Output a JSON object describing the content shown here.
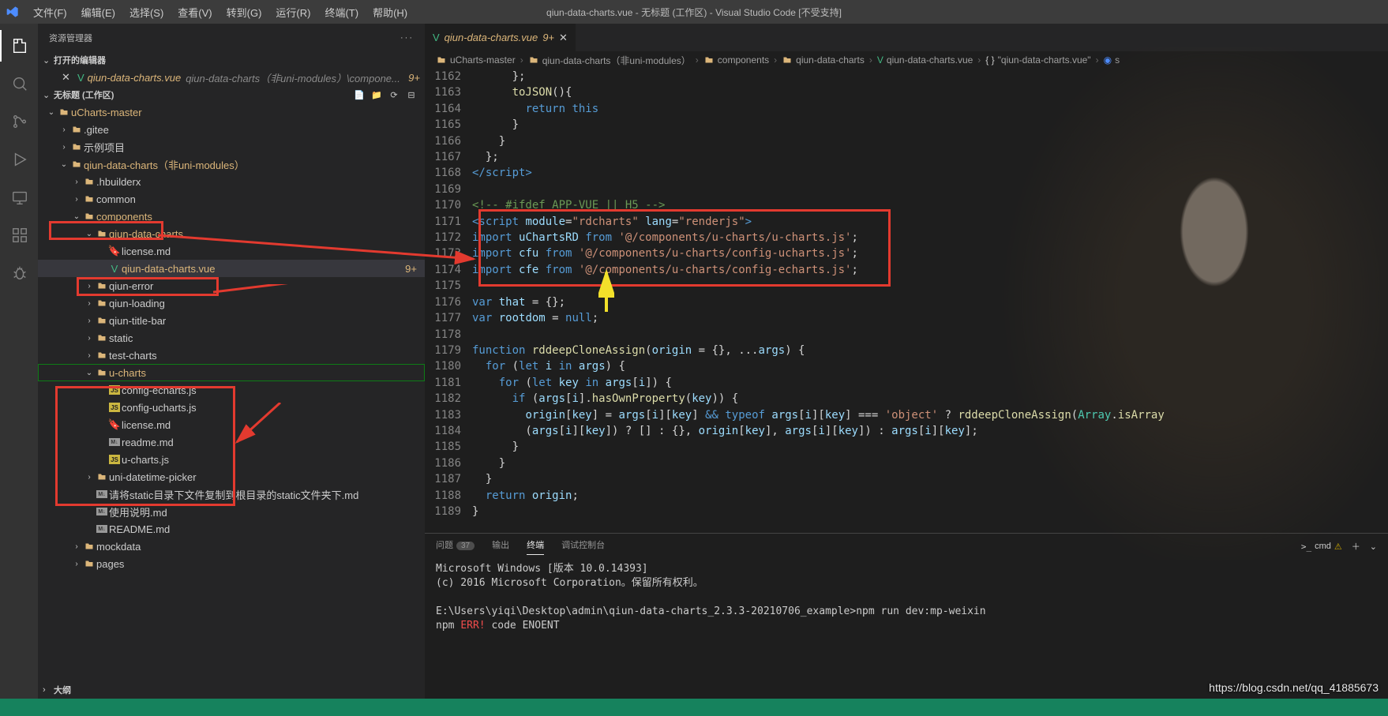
{
  "window": {
    "title": "qiun-data-charts.vue - 无标题 (工作区) - Visual Studio Code [不受支持]"
  },
  "menu": [
    "文件(F)",
    "编辑(E)",
    "选择(S)",
    "查看(V)",
    "转到(G)",
    "运行(R)",
    "终端(T)",
    "帮助(H)"
  ],
  "sidebar": {
    "title": "资源管理器",
    "openEditorsLabel": "打开的编辑器",
    "workspaceLabel": "无标题 (工作区)",
    "openEditors": [
      {
        "icon": "vue",
        "name": "qiun-data-charts.vue",
        "path": "qiun-data-charts（非uni-modules）\\compone...",
        "badge": "9+"
      }
    ],
    "tree": [
      {
        "d": 0,
        "ch": "v",
        "ico": "folder",
        "name": "uCharts-master",
        "tint": "#dcb67a"
      },
      {
        "d": 1,
        "ch": ">",
        "ico": "folder",
        "name": ".gitee"
      },
      {
        "d": 1,
        "ch": ">",
        "ico": "folder",
        "name": "示例项目"
      },
      {
        "d": 1,
        "ch": "v",
        "ico": "folder",
        "name": "qiun-data-charts（非uni-modules）",
        "tint": "#dcb67a"
      },
      {
        "d": 2,
        "ch": ">",
        "ico": "folder",
        "name": ".hbuilderx"
      },
      {
        "d": 2,
        "ch": ">",
        "ico": "folder",
        "name": "common"
      },
      {
        "d": 2,
        "ch": "v",
        "ico": "folder",
        "name": "components",
        "tint": "#dcb67a",
        "box": "components"
      },
      {
        "d": 3,
        "ch": "v",
        "ico": "folder",
        "name": "qiun-data-charts",
        "tint": "#dcb67a"
      },
      {
        "d": 4,
        "ch": "",
        "ico": "cert",
        "name": "license.md"
      },
      {
        "d": 4,
        "ch": "",
        "ico": "vue",
        "name": "qiun-data-charts.vue",
        "tint": "#dcb67a",
        "active": true,
        "badge": "9+",
        "box": "vuefile"
      },
      {
        "d": 3,
        "ch": ">",
        "ico": "folder",
        "name": "qiun-error"
      },
      {
        "d": 3,
        "ch": ">",
        "ico": "folder",
        "name": "qiun-loading"
      },
      {
        "d": 3,
        "ch": ">",
        "ico": "folder",
        "name": "qiun-title-bar"
      },
      {
        "d": 3,
        "ch": ">",
        "ico": "folder",
        "name": "static"
      },
      {
        "d": 3,
        "ch": ">",
        "ico": "folder",
        "name": "test-charts"
      },
      {
        "d": 3,
        "ch": "v",
        "ico": "folder",
        "name": "u-charts",
        "tint": "#dcb67a",
        "selgreen": true,
        "box": "ucharts"
      },
      {
        "d": 4,
        "ch": "",
        "ico": "js",
        "name": "config-echarts.js"
      },
      {
        "d": 4,
        "ch": "",
        "ico": "js",
        "name": "config-ucharts.js"
      },
      {
        "d": 4,
        "ch": "",
        "ico": "cert",
        "name": "license.md"
      },
      {
        "d": 4,
        "ch": "",
        "ico": "md",
        "name": "readme.md"
      },
      {
        "d": 4,
        "ch": "",
        "ico": "js",
        "name": "u-charts.js"
      },
      {
        "d": 3,
        "ch": ">",
        "ico": "folder",
        "name": "uni-datetime-picker"
      },
      {
        "d": 3,
        "ch": "",
        "ico": "md",
        "name": "请将static目录下文件复制到根目录的static文件夹下.md"
      },
      {
        "d": 3,
        "ch": "",
        "ico": "md",
        "name": "使用说明.md"
      },
      {
        "d": 3,
        "ch": "",
        "ico": "md",
        "name": "README.md"
      },
      {
        "d": 2,
        "ch": ">",
        "ico": "folder",
        "name": "mockdata"
      },
      {
        "d": 2,
        "ch": ">",
        "ico": "folder",
        "name": "pages"
      }
    ],
    "outlineLabel": "大纲"
  },
  "tab": {
    "icon": "vue",
    "name": "qiun-data-charts.vue",
    "badge": "9+"
  },
  "breadcrumbs": [
    {
      "ico": "folder",
      "t": "uCharts-master"
    },
    {
      "ico": "folder",
      "t": "qiun-data-charts（非uni-modules）"
    },
    {
      "ico": "folder",
      "t": "components"
    },
    {
      "ico": "folder",
      "t": "qiun-data-charts"
    },
    {
      "ico": "vue",
      "t": "qiun-data-charts.vue"
    },
    {
      "ico": "brace",
      "t": "\"qiun-data-charts.vue\""
    },
    {
      "ico": "cube",
      "t": "s"
    }
  ],
  "code": {
    "start": 1162,
    "lines": [
      {
        "html": "      };"
      },
      {
        "html": "      <span class='c-fn'>toJSON</span>(){"
      },
      {
        "html": "        <span class='c-kw'>return</span> <span class='c-this'>this</span>"
      },
      {
        "html": "      }"
      },
      {
        "html": "    }"
      },
      {
        "html": "  };"
      },
      {
        "html": "<span class='c-tag'>&lt;/script&gt;</span>"
      },
      {
        "html": ""
      },
      {
        "html": "<span class='c-com'>&lt;!-- #ifdef APP-VUE || H5 --&gt;</span>"
      },
      {
        "html": "<span class='c-tag'>&lt;script</span> <span class='c-attr'>module</span>=<span class='c-str'>\"rdcharts\"</span> <span class='c-attr'>lang</span>=<span class='c-str'>\"renderjs\"</span><span class='c-tag'>&gt;</span>"
      },
      {
        "html": "<span class='c-kw'>import</span> <span class='c-var'>uChartsRD</span> <span class='c-kw'>from</span> <span class='c-str'>'@/components/u-charts/u-charts.js'</span>;"
      },
      {
        "html": "<span class='c-kw'>import</span> <span class='c-var'>cfu</span> <span class='c-kw'>from</span> <span class='c-str'>'@/components/u-charts/config-ucharts.js'</span>;"
      },
      {
        "html": "<span class='c-kw'>import</span> <span class='c-var'>cfe</span> <span class='c-kw'>from</span> <span class='c-str'>'@/components/u-charts/config-echarts.js'</span>;"
      },
      {
        "html": ""
      },
      {
        "html": "<span class='c-kw'>var</span> <span class='c-var'>that</span> = {};"
      },
      {
        "html": "<span class='c-kw'>var</span> <span class='c-var'>rootdom</span> = <span class='c-kw'>null</span>;"
      },
      {
        "html": ""
      },
      {
        "html": "<span class='c-kw'>function</span> <span class='c-fn'>rddeepCloneAssign</span>(<span class='c-var'>origin</span> = {}, ...<span class='c-var'>args</span>) {"
      },
      {
        "html": "  <span class='c-kw'>for</span> (<span class='c-kw'>let</span> <span class='c-var'>i</span> <span class='c-kw'>in</span> <span class='c-var'>args</span>) {"
      },
      {
        "html": "    <span class='c-kw'>for</span> (<span class='c-kw'>let</span> <span class='c-var'>key</span> <span class='c-kw'>in</span> <span class='c-var'>args</span>[<span class='c-var'>i</span>]) {"
      },
      {
        "html": "      <span class='c-kw'>if</span> (<span class='c-var'>args</span>[<span class='c-var'>i</span>].<span class='c-fn'>hasOwnProperty</span>(<span class='c-var'>key</span>)) {"
      },
      {
        "html": "        <span class='c-var'>origin</span>[<span class='c-var'>key</span>] = <span class='c-var'>args</span>[<span class='c-var'>i</span>][<span class='c-var'>key</span>] <span class='c-kw'>&amp;&amp;</span> <span class='c-kw'>typeof</span> <span class='c-var'>args</span>[<span class='c-var'>i</span>][<span class='c-var'>key</span>] === <span class='c-str'>'object'</span> ? <span class='c-fn'>rddeepCloneAssign</span>(<span class='c-custom'>Array</span>.<span class='c-fn'>isArray</span>"
      },
      {
        "html": "        (<span class='c-var'>args</span>[<span class='c-var'>i</span>][<span class='c-var'>key</span>]) ? [] : {}, <span class='c-var'>origin</span>[<span class='c-var'>key</span>], <span class='c-var'>args</span>[<span class='c-var'>i</span>][<span class='c-var'>key</span>]) : <span class='c-var'>args</span>[<span class='c-var'>i</span>][<span class='c-var'>key</span>];"
      },
      {
        "html": "      }"
      },
      {
        "html": "    }"
      },
      {
        "html": "  }"
      },
      {
        "html": "  <span class='c-kw'>return</span> <span class='c-var'>origin</span>;"
      },
      {
        "html": "}"
      }
    ]
  },
  "terminal": {
    "tabs": [
      "问题",
      "输出",
      "终端",
      "调试控制台"
    ],
    "active": 2,
    "problemCount": "37",
    "right": "cmd",
    "body": "Microsoft Windows [版本 10.0.14393]\n(c) 2016 Microsoft Corporation。保留所有权利。\n\nE:\\Users\\yiqi\\Desktop\\admin\\qiun-data-charts_2.3.3-20210706_example>npm run dev:mp-weixin\nnpm ERR! code ENOENT"
  },
  "watermark": "https://blog.csdn.net/qq_41885673"
}
